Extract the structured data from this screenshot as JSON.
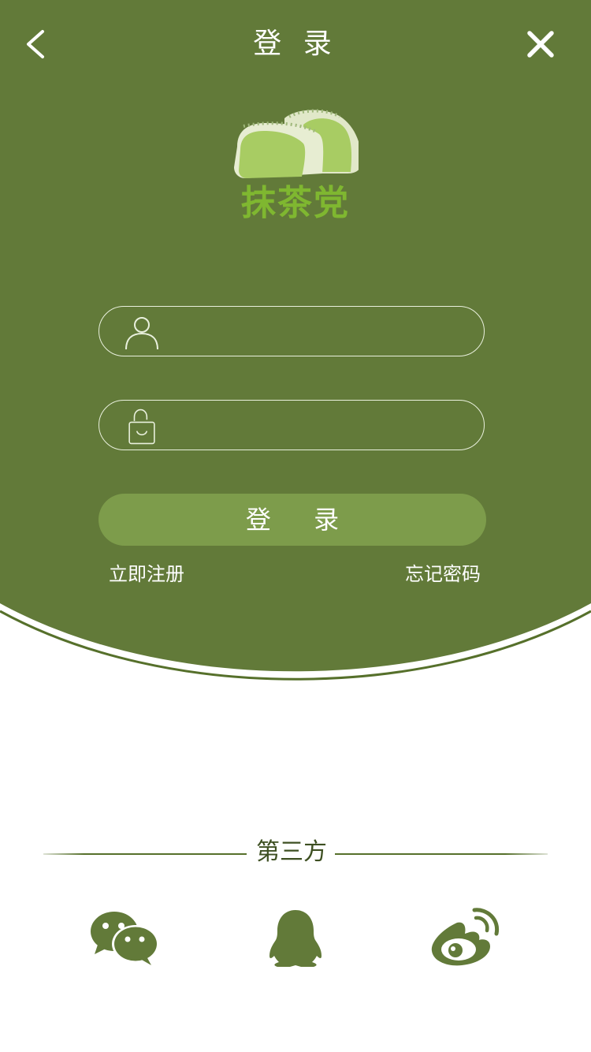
{
  "header": {
    "title": "登 录",
    "back_icon": "chevron-left-icon",
    "close_icon": "close-icon"
  },
  "logo": {
    "text": "抹茶党",
    "image": "matcha-mochi-icon"
  },
  "form": {
    "username": {
      "icon": "user-icon",
      "value": "",
      "placeholder": ""
    },
    "password": {
      "icon": "lock-icon",
      "value": "",
      "placeholder": ""
    },
    "login_label": "登 录",
    "register_label": "立即注册",
    "forgot_label": "忘记密码"
  },
  "third_party": {
    "label": "第三方",
    "providers": [
      {
        "name": "wechat",
        "icon": "wechat-icon"
      },
      {
        "name": "qq",
        "icon": "qq-icon"
      },
      {
        "name": "weibo",
        "icon": "weibo-icon"
      }
    ]
  },
  "colors": {
    "primary": "#627a39",
    "button": "#7d9c4b",
    "logo_text": "#7fb730",
    "social_icon": "#627a39",
    "background": "#ffffff"
  }
}
